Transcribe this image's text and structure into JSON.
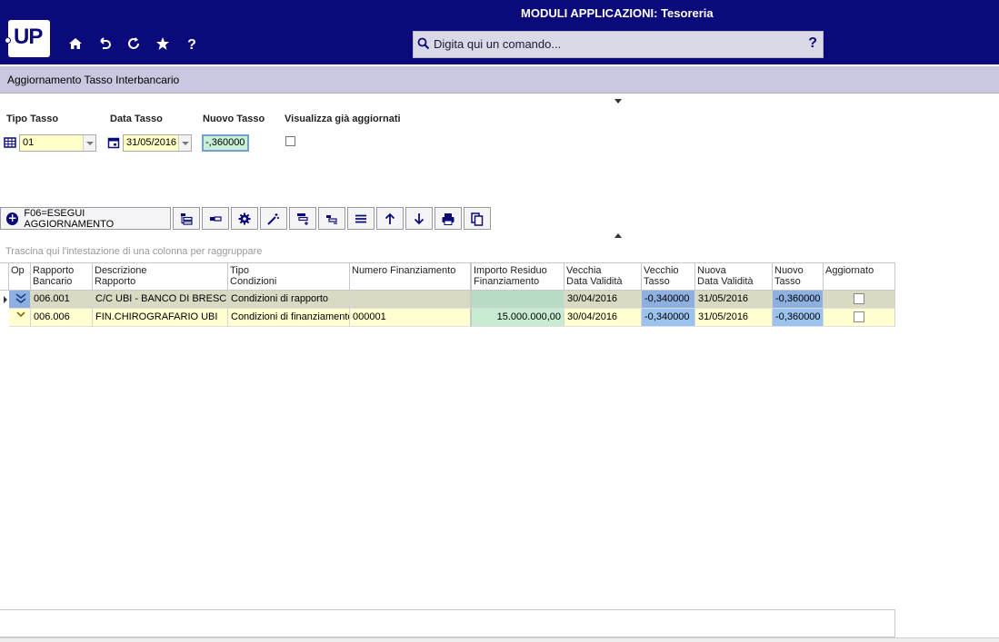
{
  "header": {
    "app_title": "MODULI APPLICAZIONI: Tesoreria",
    "logo_text": "UP",
    "command_placeholder": "Digita qui un comando...",
    "help_label": "?",
    "nav_icons": [
      "home-icon",
      "undo-icon",
      "refresh-icon",
      "star-icon",
      "help-icon"
    ]
  },
  "page": {
    "title": "Aggiornamento Tasso Interbancario"
  },
  "filters": {
    "tipo_tasso": {
      "label": "Tipo Tasso",
      "value": "01"
    },
    "data_tasso": {
      "label": "Data Tasso",
      "value": "31/05/2016"
    },
    "nuovo_tasso": {
      "label": "Nuovo Tasso",
      "value": "-,360000"
    },
    "visualizza": {
      "label": "Visualizza già aggiornati",
      "checked": false
    }
  },
  "toolbar": {
    "main_button": "F06=ESEGUI AGGIORNAMENTO",
    "icons": [
      "expand-groups-icon",
      "collapse-groups-icon",
      "settings-icon",
      "magic-wand-icon",
      "add-filter-icon",
      "remove-filter-icon",
      "menu-icon",
      "arrow-up-icon",
      "arrow-down-icon",
      "print-icon",
      "copy-icon"
    ]
  },
  "grid": {
    "group_hint": "Trascina qui l'intestazione di una colonna per raggruppare",
    "columns": [
      {
        "key": "op",
        "label": "Op",
        "label2": ""
      },
      {
        "key": "rapporto",
        "label": "Rapporto",
        "label2": "Bancario"
      },
      {
        "key": "descrizione",
        "label": "Descrizione",
        "label2": "Rapporto"
      },
      {
        "key": "tipo",
        "label": "Tipo",
        "label2": "Condizioni"
      },
      {
        "key": "numero",
        "label": "Numero Finanziamento",
        "label2": ""
      },
      {
        "key": "importo",
        "label": "Importo Residuo",
        "label2": "Finanziamento"
      },
      {
        "key": "vecchia_data",
        "label": "Vecchia",
        "label2": "Data Validità"
      },
      {
        "key": "vecchio_tasso",
        "label": "Vecchio",
        "label2": "Tasso"
      },
      {
        "key": "nuova_data",
        "label": "Nuova",
        "label2": "Data Validità"
      },
      {
        "key": "nuovo_tasso",
        "label": "Nuovo",
        "label2": "Tasso"
      },
      {
        "key": "aggiornato",
        "label": "Aggiornato",
        "label2": ""
      }
    ],
    "rows": [
      {
        "rapporto": "006.001",
        "descrizione": "C/C UBI - BANCO DI BRESCIA",
        "tipo": "Condizioni di rapporto",
        "numero": "",
        "importo": "",
        "vecchia_data": "30/04/2016",
        "vecchio_tasso": "-0,340000",
        "nuova_data": "31/05/2016",
        "nuovo_tasso": "-0,360000",
        "aggiornato": false
      },
      {
        "rapporto": "006.006",
        "descrizione": "FIN.CHIROGRAFARIO UBI",
        "tipo": "Condizioni di finanziamento",
        "numero": "000001",
        "importo": "15.000.000,00",
        "vecchia_data": "30/04/2016",
        "vecchio_tasso": "-0,340000",
        "nuova_data": "31/05/2016",
        "nuovo_tasso": "-0,360000",
        "aggiornato": false
      }
    ]
  },
  "colors": {
    "header_bg": "#0a0a7a",
    "title_bar_bg": "#c8c8e0",
    "field_bg": "#ffffc8",
    "blue_cell": "#9cc3f0",
    "green_cell": "#c8ecd2"
  }
}
